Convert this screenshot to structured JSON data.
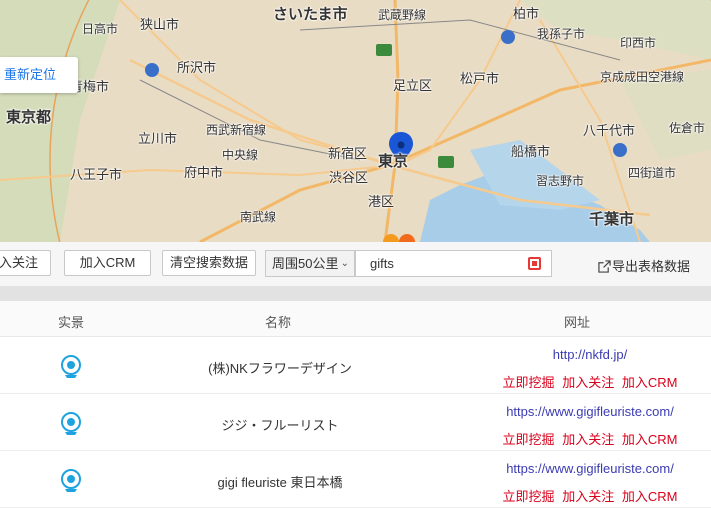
{
  "map": {
    "labels": [
      {
        "name": "さいたま市",
        "size": "big"
      },
      {
        "name": "武蔵野線",
        "size": ""
      },
      {
        "name": "柏市",
        "size": "mid"
      },
      {
        "name": "狭山市",
        "size": "mid"
      },
      {
        "name": "所沢市",
        "size": "mid"
      },
      {
        "name": "足立区",
        "size": "mid"
      },
      {
        "name": "松戸市",
        "size": "mid"
      },
      {
        "name": "我孫子市",
        "size": ""
      },
      {
        "name": "印西市",
        "size": ""
      },
      {
        "name": "京成成田空港線",
        "size": ""
      },
      {
        "name": "新宿区",
        "size": "mid"
      },
      {
        "name": "東京",
        "size": "big"
      },
      {
        "name": "渋谷区",
        "size": "mid"
      },
      {
        "name": "港区",
        "size": "mid"
      },
      {
        "name": "船橋市",
        "size": "mid"
      },
      {
        "name": "八千代市",
        "size": "mid"
      },
      {
        "name": "佐倉市",
        "size": ""
      },
      {
        "name": "習志野市",
        "size": ""
      },
      {
        "name": "四街道市",
        "size": ""
      },
      {
        "name": "千葉市",
        "size": "big"
      },
      {
        "name": "東京都",
        "size": "big"
      },
      {
        "name": "青梅市",
        "size": "mid"
      },
      {
        "name": "立川市",
        "size": "mid"
      },
      {
        "name": "西武新宿線",
        "size": ""
      },
      {
        "name": "中央線",
        "size": ""
      },
      {
        "name": "府中市",
        "size": "mid"
      },
      {
        "name": "八王子市",
        "size": "mid"
      },
      {
        "name": "南武線",
        "size": ""
      },
      {
        "name": "日高市",
        "size": ""
      }
    ],
    "relocate_label": "重新定位"
  },
  "toolbar": {
    "follow_label": "入关注",
    "crm_label": "加入CRM",
    "clear_label": "清空搜索数据",
    "radius_value": "周围50公里",
    "search_value": "gifts",
    "export_label": "导出表格数据"
  },
  "table": {
    "headers": {
      "pano": "实景",
      "name": "名称",
      "url": "网址"
    },
    "rows": [
      {
        "name": "(株)NKフラワーデザイン",
        "url": "http://nkfd.jp/"
      },
      {
        "name": "ジジ・フルーリスト",
        "url": "https://www.gigifleuriste.com/"
      },
      {
        "name": "gigi fleuriste 東日本橋",
        "url": "https://www.gigifleuriste.com/"
      }
    ],
    "actions": {
      "dig": "立即挖掘",
      "follow": "加入关注",
      "crm": "加入CRM"
    }
  },
  "colors": {
    "accent": "#1a73e8",
    "action_red": "#d9001b",
    "link": "#3b3bb3",
    "map_bg": "#e9dcc4"
  }
}
